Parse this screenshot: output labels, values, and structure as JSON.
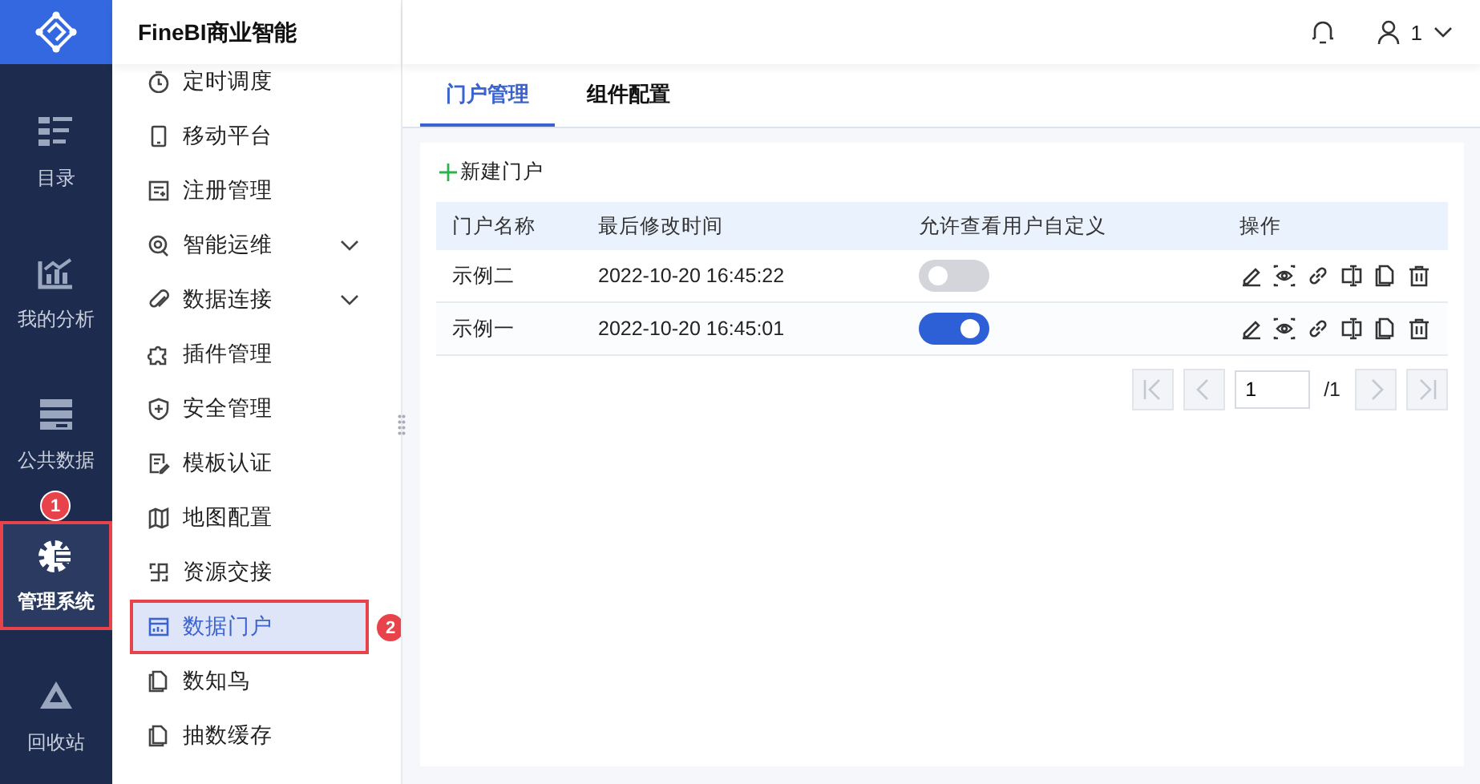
{
  "app": {
    "title": "FineBI商业智能"
  },
  "header": {
    "user": "1"
  },
  "rail": [
    {
      "label": "目录",
      "selected": false,
      "highlighted": false
    },
    {
      "label": "我的分析",
      "selected": false,
      "highlighted": false
    },
    {
      "label": "公共数据",
      "selected": false,
      "highlighted": false
    },
    {
      "label": "管理系统",
      "selected": true,
      "highlighted": true,
      "badge": "1"
    },
    {
      "label": "回收站",
      "selected": false,
      "highlighted": false
    }
  ],
  "menu": [
    {
      "label": "定时调度",
      "expandable": false,
      "selected": false,
      "highlighted": false
    },
    {
      "label": "移动平台",
      "expandable": false,
      "selected": false,
      "highlighted": false
    },
    {
      "label": "注册管理",
      "expandable": false,
      "selected": false,
      "highlighted": false
    },
    {
      "label": "智能运维",
      "expandable": true,
      "selected": false,
      "highlighted": false
    },
    {
      "label": "数据连接",
      "expandable": true,
      "selected": false,
      "highlighted": false
    },
    {
      "label": "插件管理",
      "expandable": false,
      "selected": false,
      "highlighted": false
    },
    {
      "label": "安全管理",
      "expandable": false,
      "selected": false,
      "highlighted": false
    },
    {
      "label": "模板认证",
      "expandable": false,
      "selected": false,
      "highlighted": false
    },
    {
      "label": "地图配置",
      "expandable": false,
      "selected": false,
      "highlighted": false
    },
    {
      "label": "资源交接",
      "expandable": false,
      "selected": false,
      "highlighted": false
    },
    {
      "label": "数据门户",
      "expandable": false,
      "selected": true,
      "highlighted": true,
      "badge": "2"
    },
    {
      "label": "数知鸟",
      "expandable": false,
      "selected": false,
      "highlighted": false
    },
    {
      "label": "抽数缓存",
      "expandable": false,
      "selected": false,
      "highlighted": false
    }
  ],
  "tabs": [
    {
      "label": "门户管理",
      "selected": true
    },
    {
      "label": "组件配置",
      "selected": false
    }
  ],
  "new_button": {
    "label": "新建门户"
  },
  "table": {
    "columns": [
      "门户名称",
      "最后修改时间",
      "允许查看用户自定义",
      "操作"
    ],
    "rows": [
      {
        "name": "示例二",
        "modified": "2022-10-20 16:45:22",
        "allow_custom": false
      },
      {
        "name": "示例一",
        "modified": "2022-10-20 16:45:01",
        "allow_custom": true
      }
    ]
  },
  "pagination": {
    "page": "1",
    "total": "/1"
  }
}
